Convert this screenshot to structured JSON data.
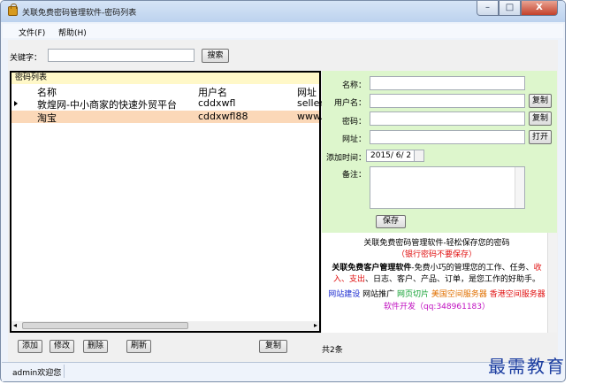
{
  "window": {
    "title": "关联免费密码管理软件-密码列表",
    "controls": [
      "–",
      "□",
      "X"
    ]
  },
  "menu": {
    "file": "文件(F)",
    "help": "帮助(H)"
  },
  "search": {
    "label": "关键字：",
    "value": "",
    "button": "搜索"
  },
  "list": {
    "title": "密码列表",
    "columns": [
      "名称",
      "用户名",
      "网址"
    ],
    "rows": [
      {
        "name": "敦煌网-中小商家的快速外贸平台",
        "username": "cddxwfl",
        "url": "seller."
      },
      {
        "name": "淘宝",
        "username": "cddxwfl88",
        "url": "www."
      }
    ],
    "selected_row": 0,
    "highlighted_row": 1
  },
  "form": {
    "name_label": "名称：",
    "user_label": "用户名：",
    "pwd_label": "密码：",
    "url_label": "网址：",
    "date_label": "添加时间：",
    "date_value": "2015/ 6/ 2",
    "note_label": "备注：",
    "copy_user": "复制",
    "copy_pwd": "复制",
    "open_url": "打开",
    "save": "保存"
  },
  "ad": {
    "line1_a": "关联免费密码管理软件-轻松保存您的密码",
    "line1_b": "（银行密码不要保存）",
    "line2_a": "关联免费客户管理软件",
    "line2_b": "-免费小巧的管理您的工作、任务、",
    "line2_c": "收入、支出",
    "line2_d": "、日志、客户、产品、订单，是您工作的好助手。",
    "link1": "网站建设",
    "link2": "网站推广",
    "link3": "网页切片",
    "link4": "美国空间服务器",
    "link5": "香港空间服务器",
    "link6": "软件开发（qq:348961183）"
  },
  "bottom": {
    "add": "添加",
    "edit": "修改",
    "delete": "删除",
    "refresh": "刷新",
    "copy": "复制",
    "count": "共2条"
  },
  "status": {
    "text": "admin欢迎您"
  },
  "watermark": "最需教育"
}
